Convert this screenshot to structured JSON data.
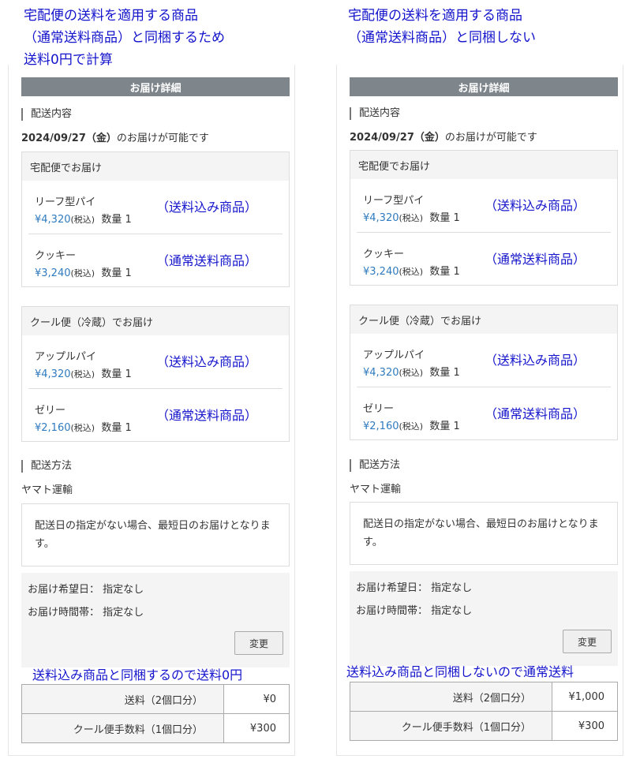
{
  "left": {
    "caption": "宅配便の送料を適用する商品\n（通常送料商品）と同梱するため\n送料0円で計算",
    "header": "お届け詳細",
    "section_content": "配送内容",
    "date": "2024/09/27（金）",
    "date_suffix": "のお届けが可能です",
    "groups": [
      {
        "title": "宅配便でお届け",
        "items": [
          {
            "name": "リーフ型パイ",
            "price": "¥4,320",
            "tax": "(税込)",
            "qty": "数量 1",
            "note": "（送料込み商品）"
          },
          {
            "name": "クッキー",
            "price": "¥3,240",
            "tax": "(税込)",
            "qty": "数量 1",
            "note": "（通常送料商品）"
          }
        ]
      },
      {
        "title": "クール便（冷蔵）でお届け",
        "items": [
          {
            "name": "アップルパイ",
            "price": "¥4,320",
            "tax": "(税込)",
            "qty": "数量 1",
            "note": "（送料込み商品）"
          },
          {
            "name": "ゼリー",
            "price": "¥2,160",
            "tax": "(税込)",
            "qty": "数量 1",
            "note": "（通常送料商品）"
          }
        ]
      }
    ],
    "section_method": "配送方法",
    "carrier": "ヤマト運輸",
    "notice": "配送日の指定がない場合、最短日のお届けとなります。",
    "desired_date": "お届け希望日：  指定なし",
    "desired_time": "お届け時間帯：  指定なし",
    "change_button": "変更",
    "bottom_note": "送料込み商品と同梱するので送料0円",
    "fees": [
      {
        "label": "送料（2個口分）",
        "value": "¥0"
      },
      {
        "label": "クール便手数料（1個口分）",
        "value": "¥300"
      }
    ]
  },
  "right": {
    "caption": "宅配便の送料を適用する商品\n（通常送料商品）と同梱しない",
    "header": "お届け詳細",
    "section_content": "配送内容",
    "date": "2024/09/27（金）",
    "date_suffix": "のお届けが可能です",
    "groups": [
      {
        "title": "宅配便でお届け",
        "items": [
          {
            "name": "リーフ型パイ",
            "price": "¥4,320",
            "tax": "(税込)",
            "qty": "数量 1",
            "note": "（送料込み商品）"
          },
          {
            "name": "クッキー",
            "price": "¥3,240",
            "tax": "(税込)",
            "qty": "数量 1",
            "note": "（通常送料商品）"
          }
        ]
      },
      {
        "title": "クール便（冷蔵）でお届け",
        "items": [
          {
            "name": "アップルパイ",
            "price": "¥4,320",
            "tax": "(税込)",
            "qty": "数量 1",
            "note": "（送料込み商品）"
          },
          {
            "name": "ゼリー",
            "price": "¥2,160",
            "tax": "(税込)",
            "qty": "数量 1",
            "note": "（通常送料商品）"
          }
        ]
      }
    ],
    "section_method": "配送方法",
    "carrier": "ヤマト運輸",
    "notice": "配送日の指定がない場合、最短日のお届けとなります。",
    "desired_date": "お届け希望日：  指定なし",
    "desired_time": "お届け時間帯：  指定なし",
    "change_button": "変更",
    "bottom_note": "送料込み商品と同梱しないので通常送料",
    "fees": [
      {
        "label": "送料（2個口分）",
        "value": "¥1,000"
      },
      {
        "label": "クール便手数料（1個口分）",
        "value": "¥300"
      }
    ]
  }
}
